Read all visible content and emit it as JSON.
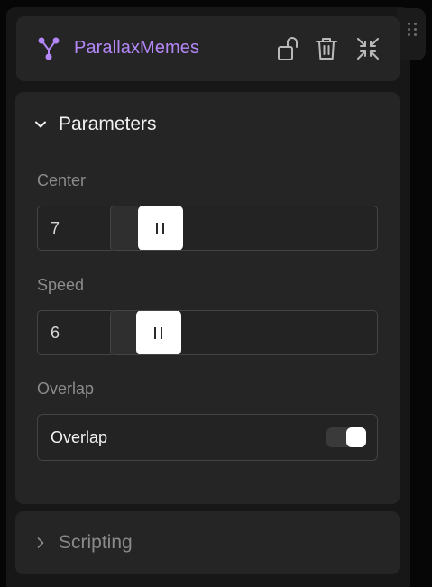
{
  "node": {
    "title": "ParallaxMemes",
    "accent_color": "#b387f8",
    "icon": "node-graph-icon"
  },
  "header_actions": [
    {
      "name": "unlock-icon"
    },
    {
      "name": "trash-icon"
    },
    {
      "name": "collapse-arrows-icon"
    }
  ],
  "parameters": {
    "title": "Parameters",
    "expanded": true,
    "center": {
      "label": "Center",
      "value": "7",
      "slider_fraction": 0.07
    },
    "speed": {
      "label": "Speed",
      "value": "6",
      "slider_fraction": 0.06
    },
    "overlap": {
      "label": "Overlap",
      "toggle_label": "Overlap",
      "checked": true
    }
  },
  "scripting": {
    "title": "Scripting",
    "expanded": false
  }
}
